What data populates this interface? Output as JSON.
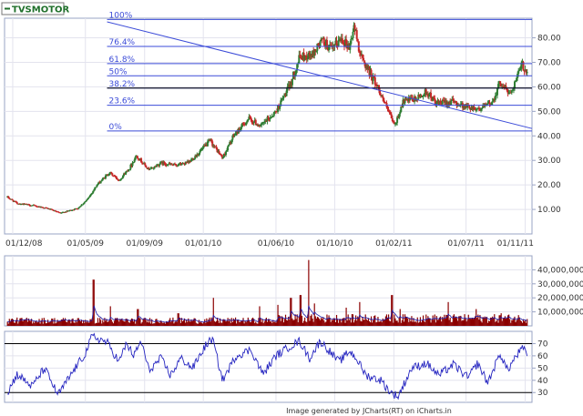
{
  "ticker": "TVSMOTOR",
  "footer": "Image generated by JCharts(RT) on iCharts.in",
  "colors": {
    "background": "#ffffff",
    "frame": "#9aa4c4",
    "grid": "#e3e3ee",
    "candle_up": "#2e7d32",
    "candle_down": "#c62828",
    "fib_line": "#3b4bd8",
    "trend_line": "#3b4bd8",
    "volume_bar": "#8b0000",
    "volume_avg": "#1a1aa8",
    "rsi_line": "#2424c0",
    "axis_text": "#333333",
    "ticker_text": "#1f6f2a"
  },
  "chart_data": [
    {
      "type": "candlestick",
      "panel": "price",
      "ylim": [
        0,
        88
      ],
      "yticks": [
        10,
        20,
        30,
        40,
        50,
        60,
        70,
        80
      ],
      "ytick_labels": [
        "10.00",
        "20.00",
        "30.00",
        "40.00",
        "50.00",
        "60.00",
        "70.00",
        "80.00"
      ],
      "x_range": [
        "2008-11-14",
        "2011-11-15"
      ],
      "x_ticks": [
        "2008-12-01",
        "2009-05-01",
        "2009-09-01",
        "2010-01-01",
        "2010-06-01",
        "2010-10-01",
        "2011-02-01",
        "2011-07-01",
        "2011-11-01"
      ],
      "x_tick_labels": [
        "01/12/08",
        "01/05/09",
        "01/09/09",
        "01/01/10",
        "01/06/10",
        "01/10/10",
        "01/02/11",
        "01/07/11",
        "01/11/11"
      ],
      "close_anchors": [
        [
          "2008-11-20",
          15
        ],
        [
          "2008-12-10",
          12.5
        ],
        [
          "2009-01-15",
          11.5
        ],
        [
          "2009-02-10",
          10.5
        ],
        [
          "2009-03-10",
          8.5
        ],
        [
          "2009-04-15",
          10.5
        ],
        [
          "2009-05-05",
          14
        ],
        [
          "2009-05-25",
          20
        ],
        [
          "2009-06-20",
          25
        ],
        [
          "2009-07-10",
          22
        ],
        [
          "2009-08-01",
          27
        ],
        [
          "2009-08-15",
          32
        ],
        [
          "2009-09-10",
          26
        ],
        [
          "2009-10-05",
          29
        ],
        [
          "2009-11-01",
          28
        ],
        [
          "2009-12-01",
          29
        ],
        [
          "2010-01-01",
          35
        ],
        [
          "2010-01-15",
          38
        ],
        [
          "2010-02-10",
          31
        ],
        [
          "2010-03-05",
          40
        ],
        [
          "2010-04-05",
          47
        ],
        [
          "2010-05-01",
          44
        ],
        [
          "2010-06-01",
          50
        ],
        [
          "2010-07-01",
          61
        ],
        [
          "2010-07-20",
          72
        ],
        [
          "2010-08-15",
          73
        ],
        [
          "2010-09-05",
          79
        ],
        [
          "2010-09-25",
          75
        ],
        [
          "2010-10-15",
          80
        ],
        [
          "2010-11-01",
          76
        ],
        [
          "2010-11-10",
          85
        ],
        [
          "2010-11-25",
          72
        ],
        [
          "2010-12-10",
          67
        ],
        [
          "2011-01-01",
          59
        ],
        [
          "2011-01-20",
          50
        ],
        [
          "2011-02-03",
          44
        ],
        [
          "2011-02-20",
          54
        ],
        [
          "2011-03-20",
          55
        ],
        [
          "2011-04-10",
          58
        ],
        [
          "2011-05-01",
          53
        ],
        [
          "2011-06-01",
          54
        ],
        [
          "2011-07-01",
          52
        ],
        [
          "2011-08-01",
          51
        ],
        [
          "2011-08-25",
          54
        ],
        [
          "2011-09-10",
          62
        ],
        [
          "2011-09-30",
          57
        ],
        [
          "2011-10-15",
          64
        ],
        [
          "2011-10-25",
          69
        ],
        [
          "2011-11-05",
          66
        ]
      ],
      "fibonacci": {
        "levels": [
          {
            "label": "100%",
            "value": 87.5
          },
          {
            "label": "76.4%",
            "value": 76.5
          },
          {
            "label": "61.8%",
            "value": 69.5
          },
          {
            "label": "50%",
            "value": 64.5
          },
          {
            "label": "38.2%",
            "value": 59.5
          },
          {
            "label": "23.6%",
            "value": 52.5
          },
          {
            "label": "0%",
            "value": 42.0
          }
        ],
        "start_date": "2009-06-15"
      },
      "trend_line": [
        [
          "2009-06-15",
          86.5
        ],
        [
          "2011-11-15",
          43.0
        ]
      ],
      "horizontal_line": 59.5
    },
    {
      "type": "bar",
      "panel": "volume",
      "ylim": [
        0,
        50000000
      ],
      "yticks": [
        10000000,
        20000000,
        30000000,
        40000000
      ],
      "ytick_labels": [
        "10,000,000",
        "20,000,000",
        "30,000,000",
        "40,000,000"
      ],
      "spikes": [
        [
          "2009-05-18",
          33000000
        ],
        [
          "2009-06-22",
          14000000
        ],
        [
          "2009-08-18",
          12000000
        ],
        [
          "2009-11-10",
          9000000
        ],
        [
          "2010-01-22",
          20000000
        ],
        [
          "2010-04-28",
          14000000
        ],
        [
          "2010-06-05",
          15000000
        ],
        [
          "2010-07-02",
          20000000
        ],
        [
          "2010-07-22",
          22000000
        ],
        [
          "2010-08-08",
          47000000
        ],
        [
          "2010-08-20",
          16000000
        ],
        [
          "2010-10-25",
          13000000
        ],
        [
          "2010-11-22",
          17000000
        ],
        [
          "2011-01-28",
          22000000
        ],
        [
          "2011-02-14",
          12000000
        ],
        [
          "2011-05-25",
          17000000
        ],
        [
          "2011-07-22",
          12000000
        ],
        [
          "2011-09-12",
          9000000
        ]
      ]
    },
    {
      "type": "line",
      "panel": "rsi",
      "ylim": [
        22,
        80
      ],
      "yticks": [
        30,
        40,
        50,
        60,
        70
      ],
      "ytick_labels": [
        "30",
        "40",
        "50",
        "60",
        "70"
      ],
      "reference_lines": [
        30,
        70
      ],
      "anchors": [
        [
          "2008-11-20",
          30
        ],
        [
          "2008-12-10",
          45
        ],
        [
          "2009-01-10",
          35
        ],
        [
          "2009-02-05",
          50
        ],
        [
          "2009-03-05",
          28
        ],
        [
          "2009-04-10",
          50
        ],
        [
          "2009-05-01",
          62
        ],
        [
          "2009-05-15",
          76
        ],
        [
          "2009-06-15",
          71
        ],
        [
          "2009-07-10",
          55
        ],
        [
          "2009-07-25",
          70
        ],
        [
          "2009-08-10",
          60
        ],
        [
          "2009-08-25",
          72
        ],
        [
          "2009-09-10",
          48
        ],
        [
          "2009-10-05",
          58
        ],
        [
          "2009-10-25",
          44
        ],
        [
          "2009-11-15",
          58
        ],
        [
          "2009-12-10",
          50
        ],
        [
          "2010-01-05",
          68
        ],
        [
          "2010-01-20",
          74
        ],
        [
          "2010-02-10",
          40
        ],
        [
          "2010-03-10",
          60
        ],
        [
          "2010-04-10",
          65
        ],
        [
          "2010-05-05",
          45
        ],
        [
          "2010-06-01",
          60
        ],
        [
          "2010-07-01",
          68
        ],
        [
          "2010-07-20",
          72
        ],
        [
          "2010-08-10",
          58
        ],
        [
          "2010-09-01",
          72
        ],
        [
          "2010-09-20",
          64
        ],
        [
          "2010-10-10",
          55
        ],
        [
          "2010-11-01",
          64
        ],
        [
          "2010-11-15",
          58
        ],
        [
          "2010-12-05",
          44
        ],
        [
          "2011-01-05",
          40
        ],
        [
          "2011-01-25",
          30
        ],
        [
          "2011-02-10",
          27
        ],
        [
          "2011-03-10",
          50
        ],
        [
          "2011-04-10",
          54
        ],
        [
          "2011-05-05",
          44
        ],
        [
          "2011-06-05",
          53
        ],
        [
          "2011-07-05",
          42
        ],
        [
          "2011-07-25",
          54
        ],
        [
          "2011-08-15",
          38
        ],
        [
          "2011-09-10",
          62
        ],
        [
          "2011-09-25",
          48
        ],
        [
          "2011-10-10",
          58
        ],
        [
          "2011-10-25",
          66
        ],
        [
          "2011-11-05",
          62
        ]
      ]
    }
  ]
}
